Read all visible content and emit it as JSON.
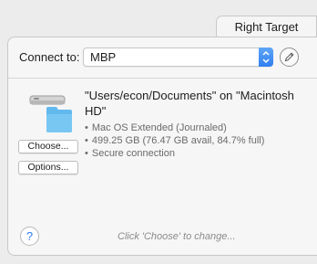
{
  "tab": {
    "label": "Right Target"
  },
  "connect": {
    "label": "Connect to:",
    "selected": "MBP"
  },
  "volume": {
    "title": "\"Users/econ/Documents\" on \"Macintosh HD\"",
    "details": [
      "Mac OS Extended (Journaled)",
      "499.25 GB (76.47 GB avail, 84.7% full)",
      "Secure connection"
    ]
  },
  "buttons": {
    "choose": "Choose...",
    "options": "Options...",
    "help": "?"
  },
  "hint": "Click 'Choose' to change...",
  "icons": {
    "edit": "pencil-icon",
    "drive": "drive-with-folder-icon",
    "dropdown": "updown-arrows-icon"
  },
  "colors": {
    "accent": "#2f7ef0",
    "folder": "#5fb8ee"
  }
}
